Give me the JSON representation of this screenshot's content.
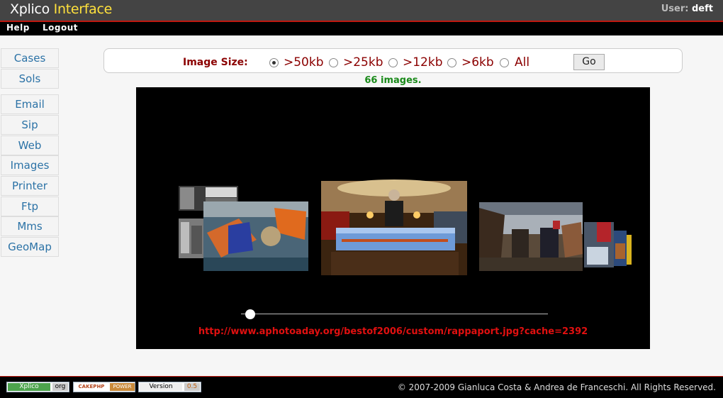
{
  "header": {
    "logo_main": "Xplico",
    "logo_accent": "Interface",
    "user_label": "User:",
    "user_name": "deft"
  },
  "menu": {
    "help": "Help",
    "logout": "Logout"
  },
  "sidebar": {
    "items": [
      {
        "label": "Cases"
      },
      {
        "label": "Sols"
      },
      {
        "label": "Email"
      },
      {
        "label": "Sip"
      },
      {
        "label": "Web"
      },
      {
        "label": "Images"
      },
      {
        "label": "Printer"
      },
      {
        "label": "Ftp"
      },
      {
        "label": "Mms"
      },
      {
        "label": "GeoMap"
      }
    ]
  },
  "filter": {
    "label": "Image Size:",
    "options": [
      ">50kb",
      ">25kb",
      ">12kb",
      ">6kb",
      "All"
    ],
    "selected": ">50kb",
    "go": "Go"
  },
  "gallery": {
    "count_text": "66 images.",
    "current_url": "http://www.aphotoaday.org/bestof2006/custom/rappaport.jpg?cache=2392",
    "slider_position": 0.03
  },
  "footer": {
    "badge_xplico": "Xplico",
    "badge_org": "org",
    "badge_cake": "CAKEPHP",
    "badge_power": "POWER",
    "badge_version": "Version",
    "badge_version_num": "0.5",
    "copyright": "© 2007-2009 Gianluca Costa & Andrea de Franceschi. All Rights Reserved."
  },
  "colors": {
    "header_bg": "#444444",
    "accent_yellow": "#ffe13c",
    "rule_red": "#c0180f",
    "link_blue": "#2b72a6",
    "label_darkred": "#8b0000",
    "count_green": "#1a8a1a",
    "url_red": "#e01010"
  }
}
